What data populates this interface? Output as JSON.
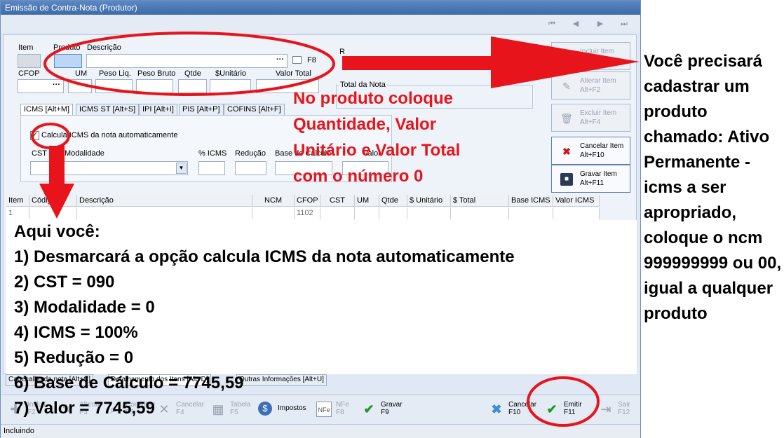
{
  "window": {
    "title": "Emissão de Contra-Nota (Produtor)",
    "nav": [
      "⏮",
      "◀",
      "▶",
      "⏭"
    ]
  },
  "fields": {
    "item": "Item",
    "produto": "Produto",
    "descricao": "Descrição",
    "lookup": "···",
    "f8": "F8",
    "cfop": "CFOP",
    "um": "UM",
    "peso_liq": "Peso Liq.",
    "peso_bruto": "Peso Bruto",
    "qtde": "Qtde",
    "unitario": "$Unitário",
    "valor_total": "Valor Total",
    "r_label": "R",
    "total_da_nota": "Total da Nota"
  },
  "tabs": [
    "ICMS [Alt+M]",
    "ICMS ST [Alt+S]",
    "IPI [Alt+I]",
    "PIS [Alt+P]",
    "COFINS [Alt+F]"
  ],
  "icms_tab": {
    "calcula_label": "Calcula ICMS da nota automaticamente",
    "calcula_checked": true,
    "cst": "CST",
    "modalidade": "Modalidade",
    "pct_icms": "% ICMS",
    "reducao": "Redução",
    "base_calculo": "Base de Cálculo",
    "valor": "Valor"
  },
  "side_buttons": [
    {
      "label": "Incluir Item",
      "shortcut": "Alt+F1",
      "icon": "add-icon",
      "enabled": false
    },
    {
      "label": "Alterar Item",
      "shortcut": "Alt+F2",
      "icon": "edit-icon",
      "enabled": false
    },
    {
      "label": "Excluir Item",
      "shortcut": "Alt+F4",
      "icon": "trash-icon",
      "enabled": false
    },
    {
      "label": "Cancelar Item",
      "shortcut": "Alt+F10",
      "icon": "cancel-x-icon",
      "enabled": true
    },
    {
      "label": "Gravar Item",
      "shortcut": "Alt+F11",
      "icon": "floppy-disk-icon",
      "enabled": true
    }
  ],
  "grid": {
    "headers": [
      "Item",
      "Código",
      "Descrição",
      "NCM",
      "CFOP",
      "CST",
      "UM",
      "Qtde",
      "$ Unitário",
      "$ Total",
      "Base ICMS",
      "Valor ICMS"
    ],
    "rows": [
      [
        "1",
        "",
        "",
        "",
        "1102",
        "",
        "",
        "",
        "",
        "",
        "",
        ""
      ]
    ]
  },
  "bottom_tabs": [
    "Cabeçalho da nota [Alt+C]",
    "Detalhamento dos Itens [Alt+D]",
    "Outras Informações [Alt+U]"
  ],
  "toolbar": [
    {
      "label": "Incluir",
      "key": "F2",
      "icon": "plus-icon",
      "enabled": false
    },
    {
      "label": "Alterar",
      "key": "F3",
      "icon": "pencil-icon",
      "enabled": false
    },
    {
      "label": "Consultar",
      "key": "F5",
      "icon": "search-icon",
      "enabled": false
    },
    {
      "label": "Cancelar",
      "key": "F4",
      "icon": "cancel-icon",
      "enabled": false
    },
    {
      "label": "Tabela",
      "key": "F5",
      "icon": "table-icon",
      "enabled": false
    },
    {
      "label": "Impostos",
      "key": "",
      "icon": "dollar-coin-icon",
      "enabled": true
    },
    {
      "label": "NFe",
      "key": "F8",
      "icon": "nfe-document-icon",
      "enabled": false
    },
    {
      "label": "Gravar",
      "key": "F9",
      "icon": "check-icon",
      "enabled": true
    },
    {
      "label": "Cancelar",
      "key": "F10",
      "icon": "x-icon",
      "enabled": true
    },
    {
      "label": "Emitir",
      "key": "F11",
      "icon": "double-check-icon",
      "enabled": true
    },
    {
      "label": "Sair",
      "key": "F12",
      "icon": "exit-icon",
      "enabled": false
    }
  ],
  "status": "Incluindo",
  "annotations": {
    "red_note": [
      "No produto coloque",
      "Quantidade, Valor",
      "Unitário e Valor Total",
      "com o número 0"
    ],
    "instructions": [
      "Aqui você:",
      "1) Desmarcará a opção calcula ICMS da nota automaticamente",
      "2) CST = 090",
      "3) Modalidade = 0",
      "4) ICMS = 100%",
      "5) Redução = 0",
      "6) Base de Cálculo = 7745,59",
      "7) Valor = 7745,59"
    ],
    "side_note": "Você precisará cadastrar um produto chamado: Ativo Permanente - icms a ser apropriado, coloque o ncm 999999999 ou 00, igual a qualquer produto",
    "accent_color": "#e8141b"
  }
}
